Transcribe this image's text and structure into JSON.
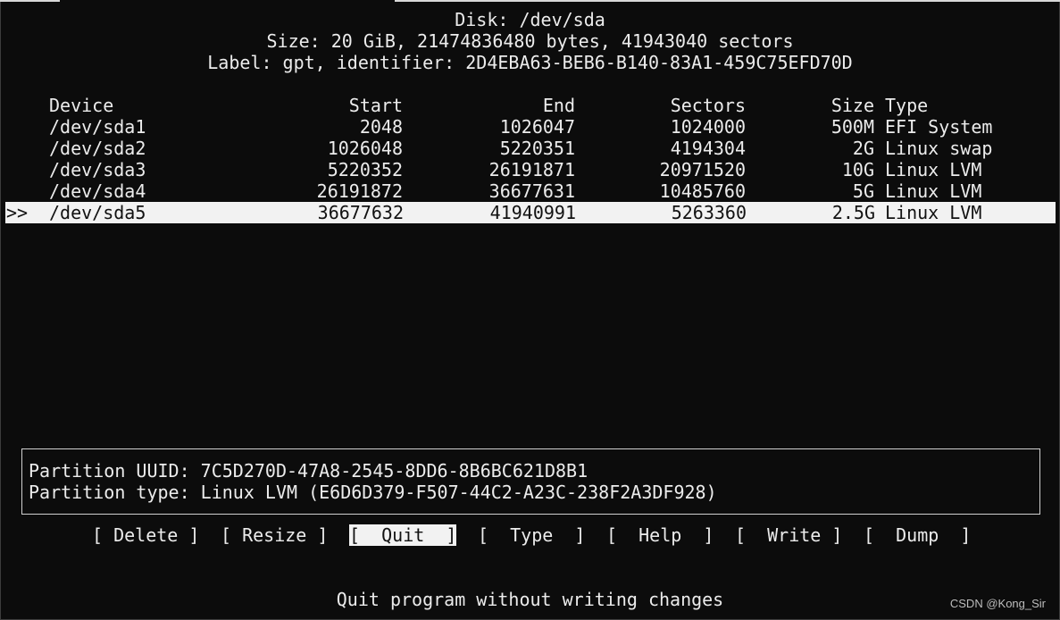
{
  "header": {
    "disk": "Disk: /dev/sda",
    "size": "Size: 20 GiB, 21474836480 bytes, 41943040 sectors",
    "label": "Label: gpt, identifier: 2D4EBA63-BEB6-B140-83A1-459C75EFD70D"
  },
  "table": {
    "columns": {
      "device": "Device",
      "start": "Start",
      "end": "End",
      "sectors": "Sectors",
      "size": "Size",
      "type": "Type"
    },
    "rows": [
      {
        "device": "/dev/sda1",
        "start": "2048",
        "end": "1026047",
        "sectors": "1024000",
        "size": "500M",
        "type": "EFI System"
      },
      {
        "device": "/dev/sda2",
        "start": "1026048",
        "end": "5220351",
        "sectors": "4194304",
        "size": "2G",
        "type": "Linux swap"
      },
      {
        "device": "/dev/sda3",
        "start": "5220352",
        "end": "26191871",
        "sectors": "20971520",
        "size": "10G",
        "type": "Linux LVM"
      },
      {
        "device": "/dev/sda4",
        "start": "26191872",
        "end": "36677631",
        "sectors": "10485760",
        "size": "5G",
        "type": "Linux LVM"
      },
      {
        "device": "/dev/sda5",
        "start": "36677632",
        "end": "41940991",
        "sectors": "5263360",
        "size": "2.5G",
        "type": "Linux LVM"
      }
    ],
    "selected_marker": ">>"
  },
  "info": {
    "uuid": "Partition UUID: 7C5D270D-47A8-2545-8DD6-8B6BC621D8B1",
    "type": "Partition type: Linux LVM (E6D6D379-F507-44C2-A23C-238F2A3DF928)"
  },
  "menu": {
    "delete": "[ Delete ]",
    "resize": "[ Resize ]",
    "quit": "[  Quit  ]",
    "type": "[  Type  ]",
    "help": "[  Help  ]",
    "write": "[  Write ]",
    "dump": "[  Dump  ]"
  },
  "status": "Quit program without writing changes",
  "watermark": "CSDN @Kong_Sir",
  "colors": {
    "background": "#0c0c0c",
    "text": "#ececec",
    "highlight": "#f2f2f2"
  }
}
